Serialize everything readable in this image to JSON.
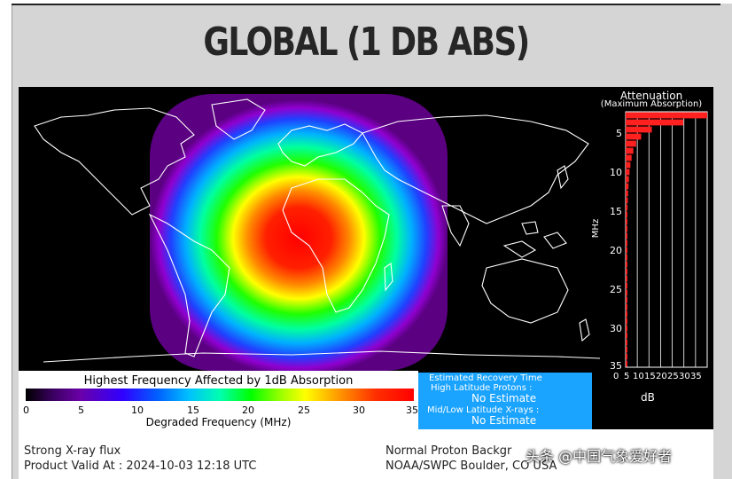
{
  "page": {
    "title": "GLOBAL (1 DB ABS)"
  },
  "attenuation": {
    "title": "Attenuation",
    "subtitle": "(Maximum Absorption)",
    "y_axis_label": "MHz",
    "x_axis_label": "dB",
    "y_ticks": [
      "5",
      "10",
      "15",
      "20",
      "25",
      "30",
      "35"
    ],
    "x_ticks": [
      "0",
      "5",
      "10",
      "15",
      "20",
      "25",
      "30",
      "35"
    ],
    "bar_color": "#ff2020"
  },
  "legend": {
    "title": "Highest Frequency Affected by 1dB Absorption",
    "ticks": [
      "0",
      "5",
      "10",
      "15",
      "20",
      "25",
      "30",
      "35"
    ],
    "axis_label": "Degraded Frequency (MHz)"
  },
  "recovery": {
    "title": "Estimated Recovery Time",
    "high_label": "High Latitude Protons :",
    "high_value": "No Estimate",
    "low_label": "Mid/Low Latitude X-rays :",
    "low_value": "No Estimate",
    "bg_color": "#1aa3ff"
  },
  "footer": {
    "flux": "Strong X-ray flux",
    "valid": "Product Valid At : 2024-10-03 12:18 UTC",
    "proton": "Normal Proton Backgr",
    "source": "NOAA/SWPC Boulder, CO USA"
  },
  "watermark": {
    "text": "头条 @中国气象爱好者"
  }
}
